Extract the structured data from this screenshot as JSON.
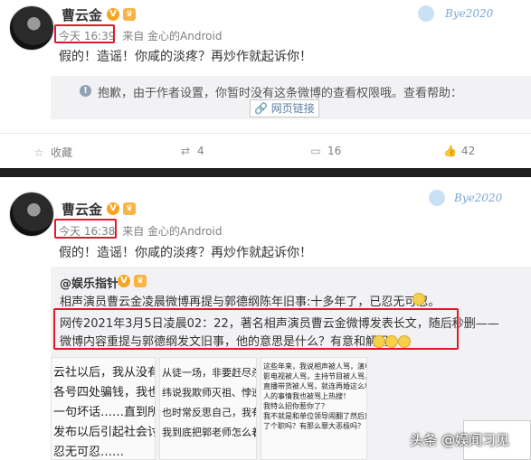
{
  "post1": {
    "author": "曹云金",
    "time": "今天 16:39",
    "source": "来自 金心的Android",
    "text": "假的！造谣！你咸的淡疼？再炒作就起诉你！",
    "deco": "Bye2020",
    "notice": "抱歉，由于作者设置，你暂时没有这条微博的查看权限哦。查看帮助：",
    "link_label": "网页链接",
    "actions": {
      "collect": "收藏",
      "repost": "4",
      "comment": "16",
      "like": "42"
    }
  },
  "post2": {
    "author": "曹云金",
    "time": "今天 16:38",
    "source": "来自 金心的Android",
    "text": "假的！造谣！你咸的淡疼？再炒作就起诉你！",
    "deco": "Bye2020",
    "repost": {
      "author": "@娱乐指针",
      "line1": "相声演员曹云金凌晨微博再提与郭德纲陈年旧事:十多年了，已忍无可忍。",
      "line2": "网传2021年3月5日凌晨02：22，著名相声演员曹云金微博发表长文，随后秒删——",
      "line3": "微博内容重提与郭德纲发文旧事，他的意思是什么？有意和解吗？"
    },
    "thumbs": [
      [
        "云社以后，我从没有",
        "各号四处骗钱，我也",
        "一句坏话……直到所",
        "发布以后引起社会讨",
        "忍无可忍……"
      ],
      [
        "从徒一场，非要赶尽杀绝",
        "",
        "纬说我欺师灭祖、悖逆",
        "也时常反思自己，我有",
        "我到底把郭老师怎么着"
      ],
      [
        "这些年来，我说相声被人骂，演电",
        "影电视被人骂，主持节目被人骂，",
        "直播带货被人骂，就连再婚这么私",
        "人的事情我也被骂上热搜！",
        "",
        "我特么招你惹你了？",
        "",
        "我不就是和单位领导闹翻了然后离",
        "了个职吗？有那么罪大恶极吗？"
      ]
    ]
  },
  "watermark": "头条 @娱闻习见"
}
